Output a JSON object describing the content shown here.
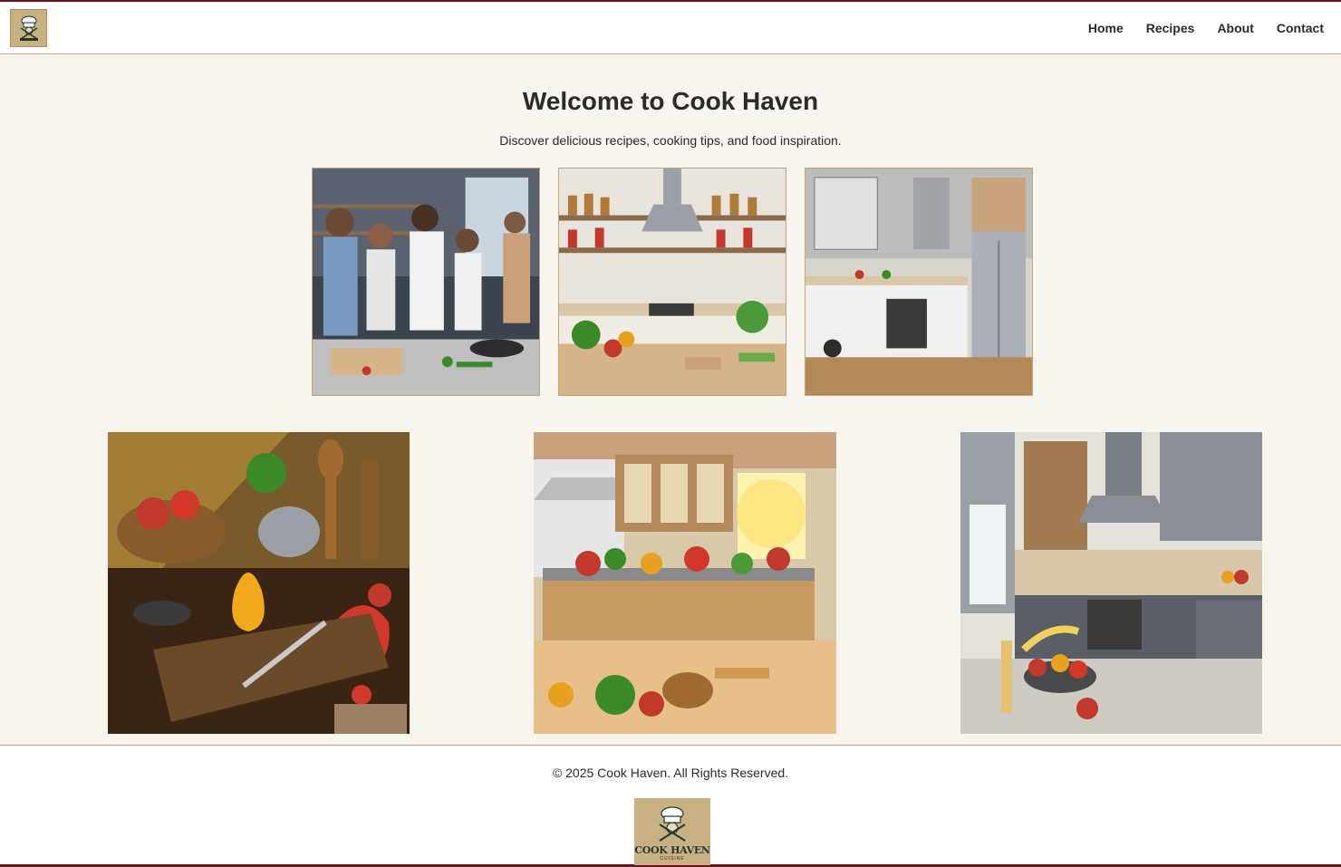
{
  "header": {
    "logo_icon": "chef-hat-logo-icon",
    "nav": [
      {
        "label": "Home"
      },
      {
        "label": "Recipes"
      },
      {
        "label": "About"
      },
      {
        "label": "Contact"
      }
    ]
  },
  "hero": {
    "title": "Welcome to Cook Haven",
    "subtitle": "Discover delicious recipes, cooking tips, and food inspiration."
  },
  "gallery_top": [
    {
      "name": "people-cooking-image"
    },
    {
      "name": "pantry-shelves-image"
    },
    {
      "name": "modern-kitchen-image"
    }
  ],
  "gallery_bottom": [
    {
      "name": "vegetables-utensils-image"
    },
    {
      "name": "sunny-kitchen-produce-image"
    },
    {
      "name": "contemporary-kitchen-image"
    }
  ],
  "footer": {
    "copyright": "© 2025 Cook Haven. All Rights Reserved.",
    "logo_brand": "COOK HAVEN",
    "logo_tag": "CUISINE"
  },
  "colors": {
    "accent": "#6b1420",
    "border": "#c8a27c",
    "background": "#f8f4ee"
  }
}
